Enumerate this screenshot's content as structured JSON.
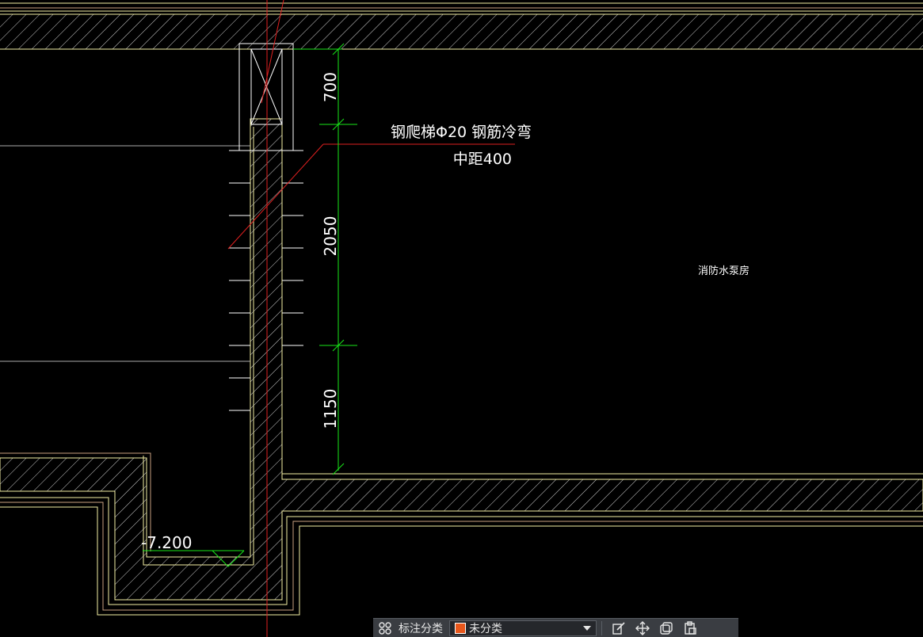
{
  "drawing": {
    "annotation_line1": "钢爬梯Φ20 钢筋冷弯",
    "annotation_line2": "中距400",
    "room_label": "消防水泵房",
    "elevation": "-7.200",
    "dimensions": [
      "700",
      "2050",
      "1150"
    ]
  },
  "toolbar": {
    "category_label": "标注分类",
    "category_value": "未分类",
    "category_color": "#e8571b",
    "icons": [
      "grid-icon",
      "edit-icon",
      "move-icon",
      "copy-icon",
      "paste-icon"
    ]
  },
  "colors": {
    "background": "#000000",
    "wall": "#f4f0a4",
    "dimension": "#19e619",
    "leader": "#e02020",
    "rung": "#ffffff",
    "text": "#ffffff"
  }
}
